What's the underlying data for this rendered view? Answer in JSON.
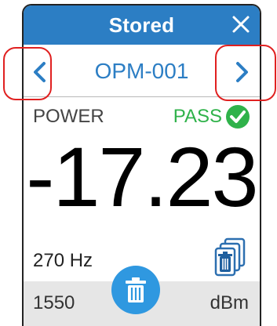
{
  "window": {
    "title": "Stored"
  },
  "navigator": {
    "current_item": "OPM-001"
  },
  "measurement": {
    "label": "POWER",
    "status": "PASS",
    "reading": "-17.23",
    "modulation": "270 Hz",
    "wavelength": "1550",
    "unit": "dBm"
  },
  "colors": {
    "primary": "#2c7ec4",
    "pass_green": "#2fb24a",
    "fab_blue": "#2f98e0",
    "annotation_red": "#e02020"
  },
  "icons": {
    "close": "close-icon",
    "prev": "chevron-left-icon",
    "next": "chevron-right-icon",
    "pass": "check-circle-icon",
    "stacked_delete": "delete-all-icon",
    "delete": "trash-icon"
  }
}
